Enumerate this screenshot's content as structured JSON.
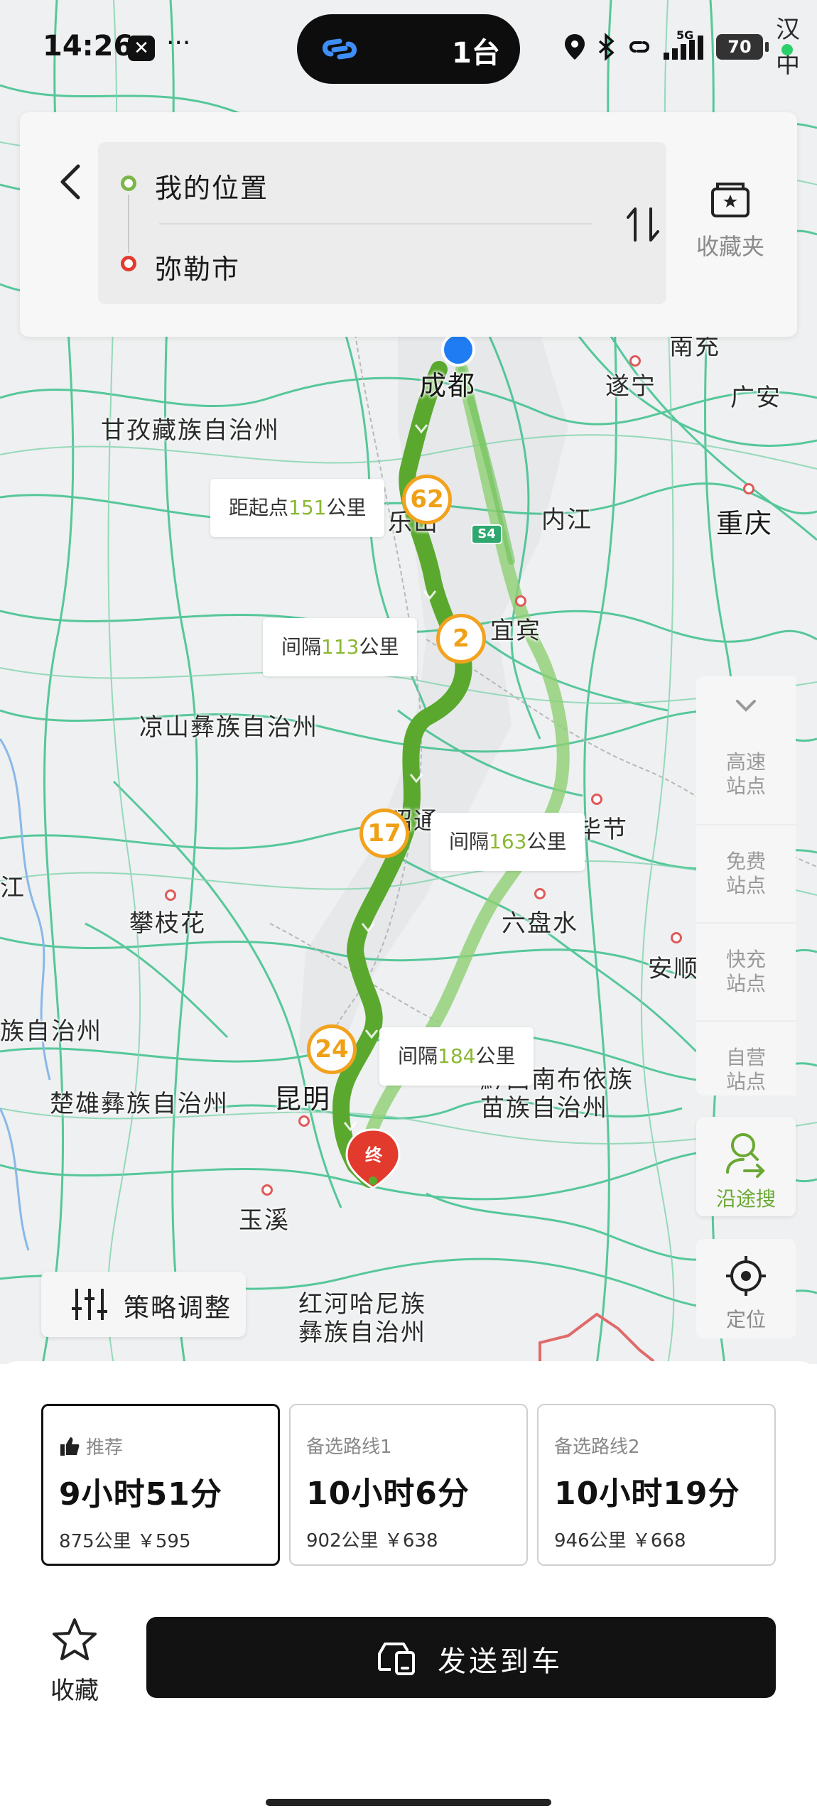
{
  "status_bar": {
    "time": "14:26",
    "app_icon_glyph": "✕",
    "more": "···",
    "island_count": "1台",
    "battery": "70",
    "network": "5G",
    "top_right_place": "汉中"
  },
  "route_card": {
    "origin": "我的位置",
    "destination": "弥勒市",
    "favorites_label": "收藏夹"
  },
  "map": {
    "places": [
      "甘孜藏族自治州",
      "成都",
      "遂宁",
      "南充",
      "广安",
      "内江",
      "重庆",
      "乐山",
      "宜宾",
      "凉山彝族自治州",
      "昭通",
      "毕节",
      "六盘水",
      "攀枝花",
      "安顺",
      "黔西南布依族苗族自治州",
      "楚雄彝族自治州",
      "昆明",
      "玉溪",
      "红河哈尼族彝族自治州",
      "江",
      "族自治州"
    ],
    "highway_shield": "S4",
    "waypoints": [
      "62",
      "2",
      "17",
      "24"
    ],
    "end_marker": "终",
    "callouts": [
      {
        "prefix": "距起点",
        "num": "151",
        "suffix": "公里"
      },
      {
        "prefix": "间隔",
        "num": "113",
        "suffix": "公里"
      },
      {
        "prefix": "间隔",
        "num": "163",
        "suffix": "公里"
      },
      {
        "prefix": "间隔",
        "num": "184",
        "suffix": "公里"
      }
    ]
  },
  "side_panel": {
    "stations": [
      "高速\n站点",
      "免费\n站点",
      "快充\n站点",
      "自营\n站点"
    ],
    "route_search": "沿途搜",
    "locate": "定位"
  },
  "strategy_button": "策略调整",
  "routes": [
    {
      "tag": "推荐",
      "duration": "9小时51分",
      "meta": "875公里 ￥595",
      "selected": true
    },
    {
      "tag": "备选路线1",
      "duration": "10小时6分",
      "meta": "902公里 ￥638",
      "selected": false
    },
    {
      "tag": "备选路线2",
      "duration": "10小时19分",
      "meta": "946公里 ￥668",
      "selected": false
    }
  ],
  "actions": {
    "favorite_label": "收藏",
    "send_label": "发送到车"
  },
  "colors": {
    "route_main": "#5aa92e",
    "route_alt": "#8fcf73",
    "roads": "#3bbf8a",
    "waypoint": "#f2a21d",
    "accent_green": "#6aa833",
    "dest_red": "#e23b2e"
  }
}
